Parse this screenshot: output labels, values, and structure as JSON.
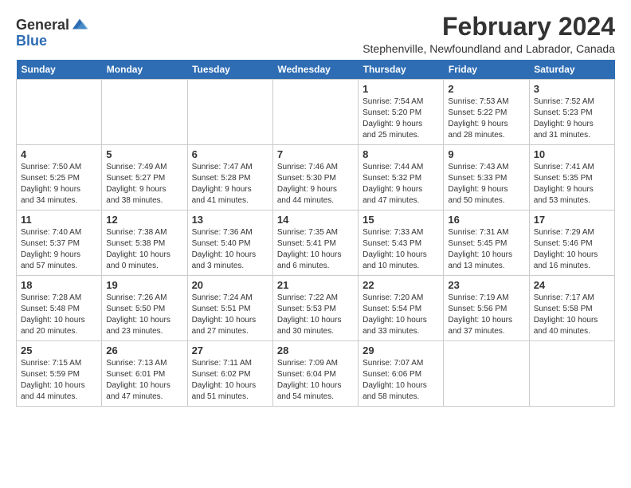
{
  "logo": {
    "text_general": "General",
    "text_blue": "Blue"
  },
  "title": {
    "month_year": "February 2024",
    "location": "Stephenville, Newfoundland and Labrador, Canada"
  },
  "weekdays": [
    "Sunday",
    "Monday",
    "Tuesday",
    "Wednesday",
    "Thursday",
    "Friday",
    "Saturday"
  ],
  "weeks": [
    [
      {
        "day": "",
        "info": ""
      },
      {
        "day": "",
        "info": ""
      },
      {
        "day": "",
        "info": ""
      },
      {
        "day": "",
        "info": ""
      },
      {
        "day": "1",
        "info": "Sunrise: 7:54 AM\nSunset: 5:20 PM\nDaylight: 9 hours\nand 25 minutes."
      },
      {
        "day": "2",
        "info": "Sunrise: 7:53 AM\nSunset: 5:22 PM\nDaylight: 9 hours\nand 28 minutes."
      },
      {
        "day": "3",
        "info": "Sunrise: 7:52 AM\nSunset: 5:23 PM\nDaylight: 9 hours\nand 31 minutes."
      }
    ],
    [
      {
        "day": "4",
        "info": "Sunrise: 7:50 AM\nSunset: 5:25 PM\nDaylight: 9 hours\nand 34 minutes."
      },
      {
        "day": "5",
        "info": "Sunrise: 7:49 AM\nSunset: 5:27 PM\nDaylight: 9 hours\nand 38 minutes."
      },
      {
        "day": "6",
        "info": "Sunrise: 7:47 AM\nSunset: 5:28 PM\nDaylight: 9 hours\nand 41 minutes."
      },
      {
        "day": "7",
        "info": "Sunrise: 7:46 AM\nSunset: 5:30 PM\nDaylight: 9 hours\nand 44 minutes."
      },
      {
        "day": "8",
        "info": "Sunrise: 7:44 AM\nSunset: 5:32 PM\nDaylight: 9 hours\nand 47 minutes."
      },
      {
        "day": "9",
        "info": "Sunrise: 7:43 AM\nSunset: 5:33 PM\nDaylight: 9 hours\nand 50 minutes."
      },
      {
        "day": "10",
        "info": "Sunrise: 7:41 AM\nSunset: 5:35 PM\nDaylight: 9 hours\nand 53 minutes."
      }
    ],
    [
      {
        "day": "11",
        "info": "Sunrise: 7:40 AM\nSunset: 5:37 PM\nDaylight: 9 hours\nand 57 minutes."
      },
      {
        "day": "12",
        "info": "Sunrise: 7:38 AM\nSunset: 5:38 PM\nDaylight: 10 hours\nand 0 minutes."
      },
      {
        "day": "13",
        "info": "Sunrise: 7:36 AM\nSunset: 5:40 PM\nDaylight: 10 hours\nand 3 minutes."
      },
      {
        "day": "14",
        "info": "Sunrise: 7:35 AM\nSunset: 5:41 PM\nDaylight: 10 hours\nand 6 minutes."
      },
      {
        "day": "15",
        "info": "Sunrise: 7:33 AM\nSunset: 5:43 PM\nDaylight: 10 hours\nand 10 minutes."
      },
      {
        "day": "16",
        "info": "Sunrise: 7:31 AM\nSunset: 5:45 PM\nDaylight: 10 hours\nand 13 minutes."
      },
      {
        "day": "17",
        "info": "Sunrise: 7:29 AM\nSunset: 5:46 PM\nDaylight: 10 hours\nand 16 minutes."
      }
    ],
    [
      {
        "day": "18",
        "info": "Sunrise: 7:28 AM\nSunset: 5:48 PM\nDaylight: 10 hours\nand 20 minutes."
      },
      {
        "day": "19",
        "info": "Sunrise: 7:26 AM\nSunset: 5:50 PM\nDaylight: 10 hours\nand 23 minutes."
      },
      {
        "day": "20",
        "info": "Sunrise: 7:24 AM\nSunset: 5:51 PM\nDaylight: 10 hours\nand 27 minutes."
      },
      {
        "day": "21",
        "info": "Sunrise: 7:22 AM\nSunset: 5:53 PM\nDaylight: 10 hours\nand 30 minutes."
      },
      {
        "day": "22",
        "info": "Sunrise: 7:20 AM\nSunset: 5:54 PM\nDaylight: 10 hours\nand 33 minutes."
      },
      {
        "day": "23",
        "info": "Sunrise: 7:19 AM\nSunset: 5:56 PM\nDaylight: 10 hours\nand 37 minutes."
      },
      {
        "day": "24",
        "info": "Sunrise: 7:17 AM\nSunset: 5:58 PM\nDaylight: 10 hours\nand 40 minutes."
      }
    ],
    [
      {
        "day": "25",
        "info": "Sunrise: 7:15 AM\nSunset: 5:59 PM\nDaylight: 10 hours\nand 44 minutes."
      },
      {
        "day": "26",
        "info": "Sunrise: 7:13 AM\nSunset: 6:01 PM\nDaylight: 10 hours\nand 47 minutes."
      },
      {
        "day": "27",
        "info": "Sunrise: 7:11 AM\nSunset: 6:02 PM\nDaylight: 10 hours\nand 51 minutes."
      },
      {
        "day": "28",
        "info": "Sunrise: 7:09 AM\nSunset: 6:04 PM\nDaylight: 10 hours\nand 54 minutes."
      },
      {
        "day": "29",
        "info": "Sunrise: 7:07 AM\nSunset: 6:06 PM\nDaylight: 10 hours\nand 58 minutes."
      },
      {
        "day": "",
        "info": ""
      },
      {
        "day": "",
        "info": ""
      }
    ]
  ]
}
